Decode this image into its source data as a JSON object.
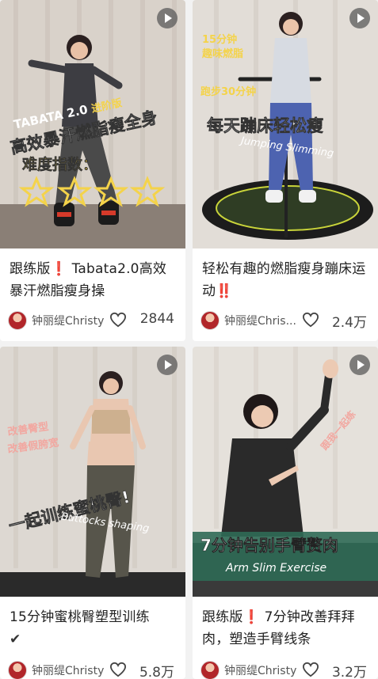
{
  "cards": [
    {
      "overlay_lines": [
        "TABATA 2.0",
        "进阶版",
        "高效暴汗燃脂瘦全身",
        "难度指数："
      ],
      "title_prefix": "跟练版",
      "title_mark": "❗",
      "title_rest": " Tabata2.0高效暴汗燃脂瘦身操",
      "author": "钟丽缇Christy",
      "likes": "2844"
    },
    {
      "overlay_lines": [
        "15分钟",
        "趣味燃脂",
        "跑步30分钟",
        "每天蹦床轻松瘦",
        "Jumping Slimming"
      ],
      "title_text": "轻松有趣的燃脂瘦身蹦床运动",
      "title_mark": "‼️",
      "author": "钟丽缇Chris...",
      "likes": "2.4万"
    },
    {
      "overlay_lines": [
        "改善臀型",
        "改善假胯宽",
        "一起训练蜜桃臀!",
        "Buttocks shaping"
      ],
      "title_text": "15分钟蜜桃臀塑型训练",
      "title_mark": "✔",
      "author": "钟丽缇Christy",
      "likes": "5.8万"
    },
    {
      "overlay_lines": [
        "跟我一起练",
        "7分钟告别手臂赘肉",
        "Arm Slim Exercise"
      ],
      "title_prefix": "跟练版",
      "title_mark": "❗",
      "title_rest": " 7分钟改善拜拜肉，塑造手臂线条",
      "author": "钟丽缇Christy",
      "likes": "3.2万"
    }
  ]
}
